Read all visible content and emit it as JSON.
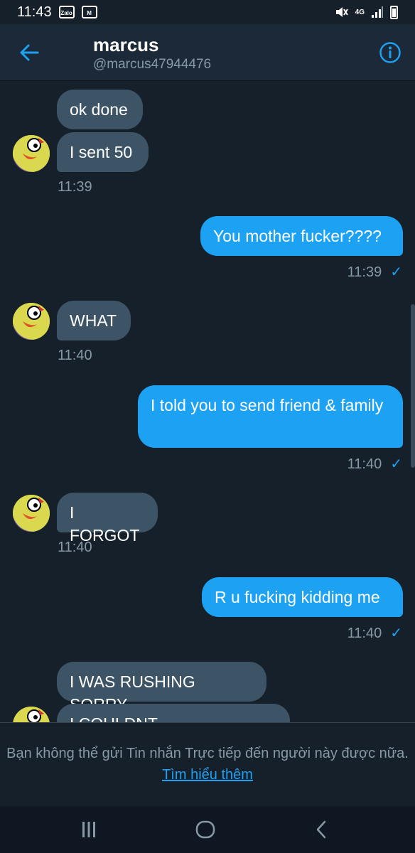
{
  "status_bar": {
    "time": "11:43",
    "zalo_label": "Zalo",
    "mail_icon": "gmail-icon",
    "network": "4G",
    "icons": [
      "mute-icon",
      "signal-icon",
      "battery-icon"
    ]
  },
  "header": {
    "name": "marcus",
    "handle": "@marcus47944476",
    "back_icon": "back-arrow-icon",
    "info_icon": "info-icon",
    "accent": "#1da1f2"
  },
  "messages": [
    {
      "from": "them",
      "text": "ok done"
    },
    {
      "from": "them",
      "text": "I sent 50",
      "time": "11:39"
    },
    {
      "from": "me",
      "text": "You mother fucker????",
      "time": "11:39"
    },
    {
      "from": "them",
      "text": "WHAT",
      "time": "11:40"
    },
    {
      "from": "me",
      "text": "I told you to send friend & family",
      "time": "11:40"
    },
    {
      "from": "them",
      "text": "I FORGOT",
      "time": "11:40"
    },
    {
      "from": "me",
      "text": "R u fucking kidding me",
      "time": "11:40"
    },
    {
      "from": "them",
      "text": "I WAS RUSHING SORRY"
    },
    {
      "from": "them",
      "text": "I COULDNT FIGNDODNGID"
    }
  ],
  "footer": {
    "notice": "Bạn không thể gửi Tin nhắn Trực tiếp đến người này được nữa.",
    "link": "Tìm hiểu thêm"
  },
  "nav": {
    "recents": "recents-icon",
    "home": "home-icon",
    "back": "back-icon"
  }
}
